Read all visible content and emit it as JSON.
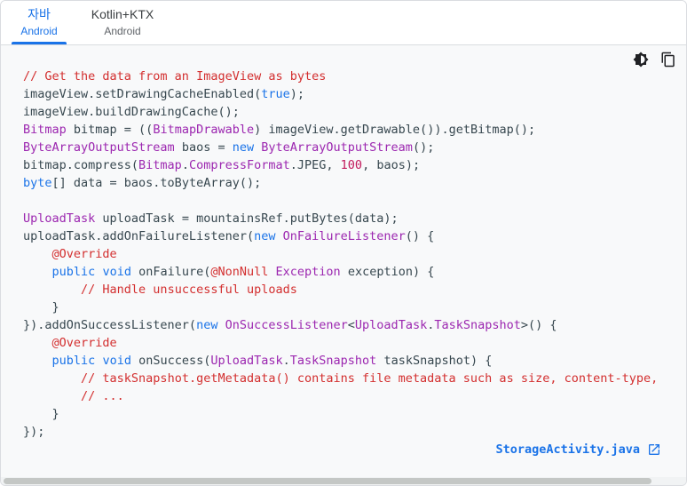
{
  "tabs": [
    {
      "title": "자바",
      "subtitle": "Android"
    },
    {
      "title": "Kotlin+KTX",
      "subtitle": "Android"
    }
  ],
  "toolbar": {
    "theme_icon": "brightness-icon",
    "copy_icon": "copy-icon"
  },
  "code": {
    "l1": "// Get the data from an ImageView as bytes",
    "l2a": "imageView.setDrawingCacheEnabled(",
    "l2b": "true",
    "l2c": ");",
    "l3": "imageView.buildDrawingCache();",
    "l4a": "Bitmap",
    "l4b": " bitmap = ((",
    "l4c": "BitmapDrawable",
    "l4d": ") imageView.getDrawable()).getBitmap();",
    "l5a": "ByteArrayOutputStream",
    "l5b": " baos = ",
    "l5c": "new",
    "l5d": " ",
    "l5e": "ByteArrayOutputStream",
    "l5f": "();",
    "l6a": "bitmap.compress(",
    "l6b": "Bitmap",
    "l6c": ".",
    "l6d": "CompressFormat",
    "l6e": ".JPEG, ",
    "l6f": "100",
    "l6g": ", baos);",
    "l7a": "byte",
    "l7b": "[] data = baos.toByteArray();",
    "l9a": "UploadTask",
    "l9b": " uploadTask = mountainsRef.putBytes(data);",
    "l10a": "uploadTask.addOnFailureListener(",
    "l10b": "new",
    "l10c": " ",
    "l10d": "OnFailureListener",
    "l10e": "() {",
    "l11a": "    ",
    "l11b": "@Override",
    "l12a": "    ",
    "l12b": "public",
    "l12c": " ",
    "l12d": "void",
    "l12e": " onFailure(",
    "l12f": "@NonNull",
    "l12g": " ",
    "l12h": "Exception",
    "l12i": " exception) {",
    "l13a": "        ",
    "l13b": "// Handle unsuccessful uploads",
    "l14": "    }",
    "l15a": "}).addOnSuccessListener(",
    "l15b": "new",
    "l15c": " ",
    "l15d": "OnSuccessListener",
    "l15e": "<",
    "l15f": "UploadTask",
    "l15g": ".",
    "l15h": "TaskSnapshot",
    "l15i": ">() {",
    "l16a": "    ",
    "l16b": "@Override",
    "l17a": "    ",
    "l17b": "public",
    "l17c": " ",
    "l17d": "void",
    "l17e": " onSuccess(",
    "l17f": "UploadTask",
    "l17g": ".",
    "l17h": "TaskSnapshot",
    "l17i": " taskSnapshot) {",
    "l18a": "        ",
    "l18b": "// taskSnapshot.getMetadata() contains file metadata such as size, content-type,",
    "l19a": "        ",
    "l19b": "// ...",
    "l20": "    }",
    "l21": "});"
  },
  "file_link": {
    "label": "StorageActivity.java",
    "icon": "open-in-new-icon"
  },
  "colors": {
    "accent": "#1a73e8",
    "comment": "#d32f2f",
    "type": "#9c27b0",
    "number": "#c2185b",
    "text": "#37474f"
  }
}
